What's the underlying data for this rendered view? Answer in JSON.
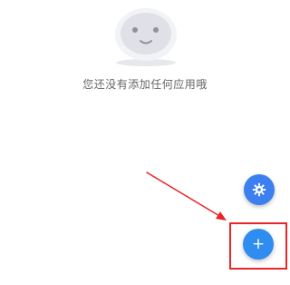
{
  "empty_state": {
    "message": "您还没有添加任何应用哦"
  },
  "fab_settings": {
    "icon": "gear-icon",
    "color": "#3b7ff0"
  },
  "fab_add": {
    "icon": "plus-icon",
    "label": "+",
    "color": "#2f8cf0"
  },
  "annotation": {
    "color": "#e8262a"
  }
}
